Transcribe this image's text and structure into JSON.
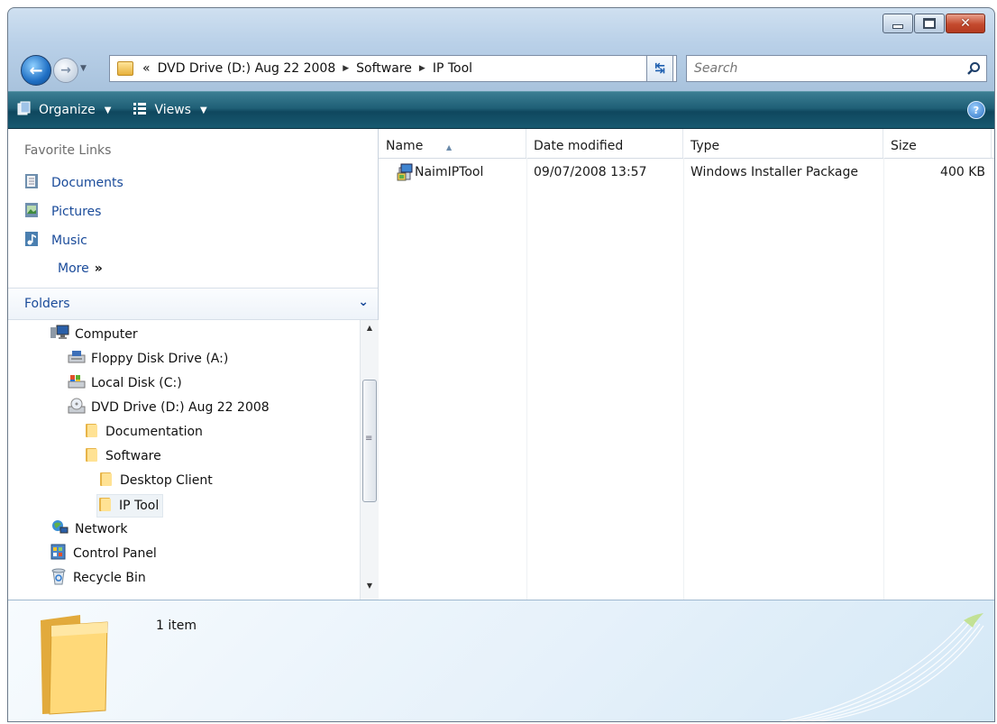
{
  "window": {
    "controls": {
      "minimize_icon": "minimize-icon",
      "maximize_icon": "maximize-icon",
      "close_icon": "close-icon"
    }
  },
  "navigation": {
    "breadcrumb": [
      "«",
      "DVD Drive (D:) Aug 22 2008",
      "Software",
      "IP Tool"
    ],
    "search_placeholder": "Search"
  },
  "toolbar": {
    "organize_label": "Organize",
    "views_label": "Views"
  },
  "favorites": {
    "title": "Favorite Links",
    "items": [
      {
        "label": "Documents",
        "icon": "documents-icon"
      },
      {
        "label": "Pictures",
        "icon": "pictures-icon"
      },
      {
        "label": "Music",
        "icon": "music-icon"
      }
    ],
    "more_label": "More",
    "more_glyph": "»"
  },
  "folders": {
    "title": "Folders",
    "tree": [
      {
        "label": "Computer",
        "icon": "computer-icon"
      },
      {
        "label": "Floppy Disk Drive (A:)",
        "icon": "floppy-drive-icon"
      },
      {
        "label": "Local Disk (C:)",
        "icon": "local-disk-icon"
      },
      {
        "label": "DVD Drive (D:) Aug 22 2008",
        "icon": "dvd-drive-icon"
      },
      {
        "label": "Documentation",
        "icon": "folder-icon"
      },
      {
        "label": "Software",
        "icon": "folder-icon"
      },
      {
        "label": "Desktop Client",
        "icon": "folder-icon"
      },
      {
        "label": "IP Tool",
        "icon": "folder-icon",
        "selected": true
      },
      {
        "label": "Network",
        "icon": "network-icon"
      },
      {
        "label": "Control Panel",
        "icon": "control-panel-icon"
      },
      {
        "label": "Recycle Bin",
        "icon": "recycle-bin-icon"
      }
    ]
  },
  "file_list": {
    "columns": [
      "Name",
      "Date modified",
      "Type",
      "Size"
    ],
    "rows": [
      {
        "name": "NaimIPTool",
        "date": "09/07/2008 13:57",
        "type": "Windows Installer Package",
        "size": "400 KB"
      }
    ]
  },
  "details_pane": {
    "item_count": "1 item"
  },
  "colors": {
    "command_bar": "#1f5f76",
    "link": "#1a4b9a",
    "window_frame": "#b9d0e8"
  }
}
